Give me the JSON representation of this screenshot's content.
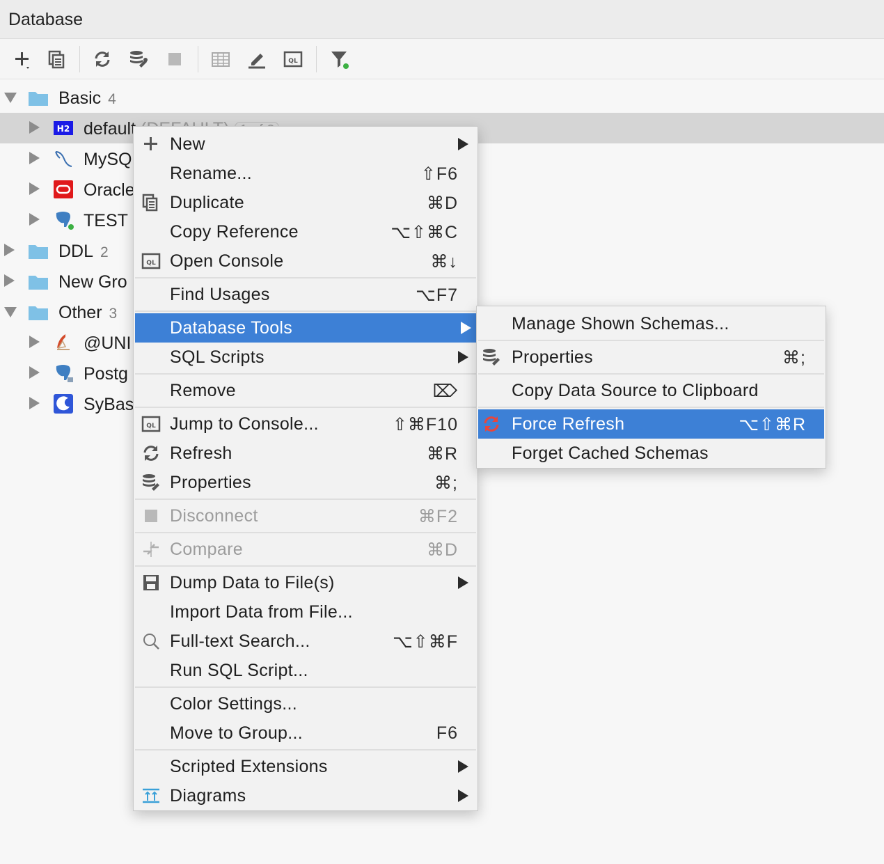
{
  "panel": {
    "title": "Database"
  },
  "toolbar": {
    "buttons": [
      {
        "name": "add-button",
        "icon": "plus-icon"
      },
      {
        "name": "duplicate-button",
        "icon": "duplicate-icon"
      },
      {
        "name": "refresh-button",
        "icon": "refresh-icon"
      },
      {
        "name": "properties-button",
        "icon": "db-properties-icon"
      },
      {
        "name": "stop-button",
        "icon": "stop-icon"
      },
      {
        "name": "table-view-button",
        "icon": "table-icon"
      },
      {
        "name": "edit-button",
        "icon": "pencil-icon"
      },
      {
        "name": "console-button",
        "icon": "console-icon"
      },
      {
        "name": "filter-button",
        "icon": "filter-icon"
      }
    ]
  },
  "tree": {
    "groups": {
      "basic": {
        "label": "Basic",
        "count": "4"
      },
      "ddl": {
        "label": "DDL",
        "count": "2"
      },
      "new_group": {
        "label": "New Gro"
      },
      "other": {
        "label": "Other",
        "count": "3"
      }
    },
    "sources": {
      "default": {
        "label": "default",
        "suffix": "(DEFAULT)",
        "badge": "1 of 2",
        "icon": "h2-icon",
        "icon_text": "H2"
      },
      "mysql": {
        "label": "MySQ",
        "icon": "mysql-dolphin-icon"
      },
      "oracle": {
        "label": "Oracle",
        "icon": "oracle-icon"
      },
      "test": {
        "label": "TEST",
        "icon": "postgres-elephant-icon"
      },
      "uni": {
        "label": "@UNI",
        "icon": "sqlserver-icon"
      },
      "postgres": {
        "label": "Postg",
        "icon": "postgres-elephant-icon"
      },
      "sybase": {
        "label": "SyBas",
        "icon": "sybase-icon"
      }
    }
  },
  "context_menu": {
    "items": {
      "new": {
        "label": "New",
        "icon": "plus-icon"
      },
      "rename": {
        "label": "Rename...",
        "shortcut": "⇧F6"
      },
      "duplicate": {
        "label": "Duplicate",
        "shortcut": "⌘D",
        "icon": "duplicate-icon"
      },
      "copy_reference": {
        "label": "Copy Reference",
        "shortcut": "⌥⇧⌘C"
      },
      "open_console": {
        "label": "Open Console",
        "shortcut": "⌘↓",
        "icon": "console-icon"
      },
      "find_usages": {
        "label": "Find Usages",
        "shortcut": "⌥F7"
      },
      "database_tools": {
        "label": "Database Tools"
      },
      "sql_scripts": {
        "label": "SQL Scripts"
      },
      "remove": {
        "label": "Remove",
        "shortcut": "⌦"
      },
      "jump_to_console": {
        "label": "Jump to Console...",
        "shortcut": "⇧⌘F10",
        "icon": "console-icon"
      },
      "refresh": {
        "label": "Refresh",
        "shortcut": "⌘R",
        "icon": "refresh-icon"
      },
      "properties": {
        "label": "Properties",
        "shortcut": "⌘;",
        "icon": "db-properties-icon"
      },
      "disconnect": {
        "label": "Disconnect",
        "shortcut": "⌘F2",
        "icon": "stop-icon"
      },
      "compare": {
        "label": "Compare",
        "shortcut": "⌘D",
        "icon": "compare-icon"
      },
      "dump_data": {
        "label": "Dump Data to File(s)",
        "icon": "save-icon"
      },
      "import_data": {
        "label": "Import Data from File..."
      },
      "full_text_search": {
        "label": "Full-text Search...",
        "shortcut": "⌥⇧⌘F",
        "icon": "search-icon"
      },
      "run_sql_script": {
        "label": "Run SQL Script..."
      },
      "color_settings": {
        "label": "Color Settings..."
      },
      "move_to_group": {
        "label": "Move to Group...",
        "shortcut": "F6"
      },
      "scripted_extensions": {
        "label": "Scripted Extensions"
      },
      "diagrams": {
        "label": "Diagrams",
        "icon": "diagram-icon"
      }
    }
  },
  "submenu": {
    "items": {
      "manage_schemas": {
        "label": "Manage Shown Schemas..."
      },
      "properties": {
        "label": "Properties",
        "shortcut": "⌘;",
        "icon": "db-properties-icon"
      },
      "copy_data_source": {
        "label": "Copy Data Source to Clipboard"
      },
      "force_refresh": {
        "label": "Force Refresh",
        "shortcut": "⌥⇧⌘R",
        "icon": "force-refresh-icon"
      },
      "forget_cached": {
        "label": "Forget Cached Schemas"
      }
    }
  },
  "colors": {
    "highlight": "#3d80d6",
    "selection_row": "#d5d5d5",
    "folder": "#7fc1e6",
    "status_green": "#3cb043",
    "h2_blue": "#1a1ae6",
    "oracle_red": "#e0191b",
    "force_refresh_red": "#e8463c"
  }
}
